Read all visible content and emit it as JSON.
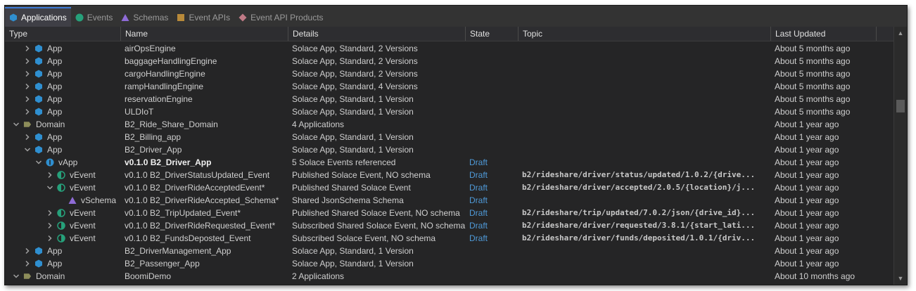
{
  "tabs": [
    {
      "label": "Applications",
      "icon": "hexagon-blue-icon",
      "active": true
    },
    {
      "label": "Events",
      "icon": "circle-teal-icon",
      "active": false
    },
    {
      "label": "Schemas",
      "icon": "triangle-purple-icon",
      "active": false
    },
    {
      "label": "Event APIs",
      "icon": "square-gold-icon",
      "active": false
    },
    {
      "label": "Event API Products",
      "icon": "diamond-pink-icon",
      "active": false
    }
  ],
  "columns": {
    "type": "Type",
    "name": "Name",
    "details": "Details",
    "state": "State",
    "topic": "Topic",
    "updated": "Last Updated"
  },
  "colors": {
    "app": "#2f8fd0",
    "domain": "#8d8d5a",
    "event": "#26a07a",
    "schema": "#8e6bd6",
    "eventapi": "#b88a3a",
    "product": "#c07a86",
    "draft": "#4f9ad8"
  },
  "rows": [
    {
      "level": 1,
      "expand": "collapsed",
      "icon": "app",
      "type": "App",
      "name": "airOpsEngine",
      "details": "Solace App, Standard, 2 Versions",
      "state": "",
      "topic": "",
      "updated": "About 5 months ago"
    },
    {
      "level": 1,
      "expand": "collapsed",
      "icon": "app",
      "type": "App",
      "name": "baggageHandlingEngine",
      "details": "Solace App, Standard, 2 Versions",
      "state": "",
      "topic": "",
      "updated": "About 5 months ago"
    },
    {
      "level": 1,
      "expand": "collapsed",
      "icon": "app",
      "type": "App",
      "name": "cargoHandlingEngine",
      "details": "Solace App, Standard, 2 Versions",
      "state": "",
      "topic": "",
      "updated": "About 5 months ago"
    },
    {
      "level": 1,
      "expand": "collapsed",
      "icon": "app",
      "type": "App",
      "name": "rampHandlingEngine",
      "details": "Solace App, Standard, 4 Versions",
      "state": "",
      "topic": "",
      "updated": "About 5 months ago"
    },
    {
      "level": 1,
      "expand": "collapsed",
      "icon": "app",
      "type": "App",
      "name": "reservationEngine",
      "details": "Solace App, Standard, 1 Version",
      "state": "",
      "topic": "",
      "updated": "About 5 months ago"
    },
    {
      "level": 1,
      "expand": "collapsed",
      "icon": "app",
      "type": "App",
      "name": "ULDIoT",
      "details": "Solace App, Standard, 1 Version",
      "state": "",
      "topic": "",
      "updated": "About 5 months ago"
    },
    {
      "level": 0,
      "expand": "expanded",
      "icon": "domain",
      "type": "Domain",
      "name": "B2_Ride_Share_Domain",
      "details": "4 Applications",
      "state": "",
      "topic": "",
      "updated": "About 1 year ago"
    },
    {
      "level": 1,
      "expand": "collapsed",
      "icon": "app",
      "type": "App",
      "name": "B2_Billing_app",
      "details": "Solace App, Standard, 1 Version",
      "state": "",
      "topic": "",
      "updated": "About 1 year ago"
    },
    {
      "level": 1,
      "expand": "expanded",
      "icon": "app",
      "type": "App",
      "name": "B2_Driver_App",
      "details": "Solace App, Standard, 1 Version",
      "state": "",
      "topic": "",
      "updated": "About 1 year ago"
    },
    {
      "level": 2,
      "expand": "expanded",
      "icon": "vapp",
      "type": "vApp",
      "name": "v0.1.0 B2_Driver_App",
      "details": "5 Solace Events referenced",
      "state": "Draft",
      "topic": "",
      "updated": "About 1 year ago",
      "bold": true
    },
    {
      "level": 3,
      "expand": "collapsed",
      "icon": "vevent-pub",
      "type": "vEvent",
      "name": "v0.1.0 B2_DriverStatusUpdated_Event",
      "details": "Published Solace Event, NO schema",
      "state": "Draft",
      "topic": "b2/rideshare/driver/status/updated/1.0.2/{drive...",
      "updated": "About 1 year ago"
    },
    {
      "level": 3,
      "expand": "expanded",
      "icon": "vevent-pub",
      "type": "vEvent",
      "name": "v0.1.0 B2_DriverRideAcceptedEvent*",
      "details": "Published Shared Solace Event",
      "state": "Draft",
      "topic": "b2/rideshare/driver/accepted/2.0.5/{location}/j...",
      "updated": "About 1 year ago"
    },
    {
      "level": 4,
      "expand": "none",
      "icon": "schema",
      "type": "vSchema",
      "name": "v0.1.0 B2_DriverRideAccepted_Schema*",
      "details": "Shared JsonSchema Schema",
      "state": "Draft",
      "topic": "",
      "updated": "About 1 year ago"
    },
    {
      "level": 3,
      "expand": "collapsed",
      "icon": "vevent-pub",
      "type": "vEvent",
      "name": "v0.1.0 B2_TripUpdated_Event*",
      "details": "Published Shared Solace Event, NO schema",
      "state": "Draft",
      "topic": "b2/rideshare/trip/updated/7.0.2/json/{drive_id}...",
      "updated": "About 1 year ago"
    },
    {
      "level": 3,
      "expand": "collapsed",
      "icon": "vevent-sub",
      "type": "vEvent",
      "name": "v0.1.0 B2_DriverRideRequested_Event*",
      "details": "Subscribed Shared Solace Event, NO schema",
      "state": "Draft",
      "topic": "b2/rideshare/driver/requested/3.8.1/{start_lati...",
      "updated": "About 1 year ago"
    },
    {
      "level": 3,
      "expand": "collapsed",
      "icon": "vevent-sub",
      "type": "vEvent",
      "name": "v0.1.0 B2_FundsDeposted_Event",
      "details": "Subscribed Solace Event, NO schema",
      "state": "Draft",
      "topic": "b2/rideshare/driver/funds/deposited/1.0.1/{driv...",
      "updated": "About 1 year ago"
    },
    {
      "level": 1,
      "expand": "collapsed",
      "icon": "app",
      "type": "App",
      "name": "B2_DriverManagement_App",
      "details": "Solace App, Standard, 1 Version",
      "state": "",
      "topic": "",
      "updated": "About 1 year ago"
    },
    {
      "level": 1,
      "expand": "collapsed",
      "icon": "app",
      "type": "App",
      "name": "B2_Passenger_App",
      "details": "Solace App, Standard, 1 Version",
      "state": "",
      "topic": "",
      "updated": "About 1 year ago"
    },
    {
      "level": 0,
      "expand": "expanded",
      "icon": "domain",
      "type": "Domain",
      "name": "BoomiDemo",
      "details": "2 Applications",
      "state": "",
      "topic": "",
      "updated": "About 10 months ago"
    }
  ]
}
